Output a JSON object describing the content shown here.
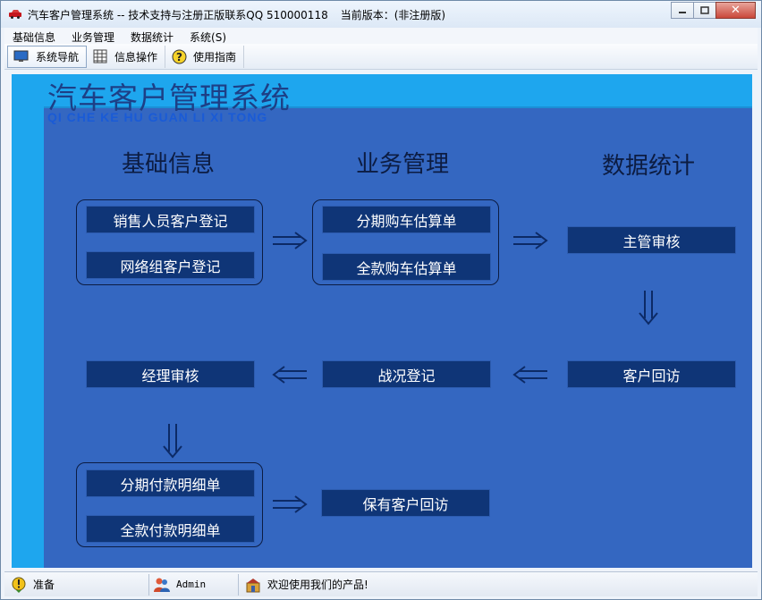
{
  "window": {
    "title": "汽车客户管理系统 -- 技术支持与注册正版联系QQ 510000118",
    "version_label": "当前版本：(非注册版)",
    "minimize": "▭",
    "maximize": "□",
    "close": "✕"
  },
  "menu": [
    {
      "label": "基础信息"
    },
    {
      "label": "业务管理"
    },
    {
      "label": "数据统计"
    },
    {
      "label": "系统(S)"
    }
  ],
  "toolbar": [
    {
      "label": "系统导航",
      "icon": "monitor-icon"
    },
    {
      "label": "信息操作",
      "icon": "grid-icon"
    },
    {
      "label": "使用指南",
      "icon": "help-icon"
    }
  ],
  "banner": {
    "title": "汽车客户管理系统",
    "subtitle": "QI CHE KE HU GUAN LI XI TONG"
  },
  "sections": {
    "basic": "基础信息",
    "business": "业务管理",
    "stats": "数据统计"
  },
  "flow": {
    "sales_register": "销售人员客户登记",
    "network_register": "网络组客户登记",
    "installment_estimate": "分期购车估算单",
    "full_estimate": "全款购车估算单",
    "manager_review": "主管审核",
    "customer_visit": "客户回访",
    "battle_register": "战况登记",
    "manager_audit": "经理审核",
    "installment_detail": "分期付款明细单",
    "full_detail": "全款付款明细单",
    "retained_visit": "保有客户回访"
  },
  "status": {
    "ready": "准备",
    "user": "Admin",
    "welcome": "欢迎使用我们的产品!"
  },
  "colors": {
    "canvas": "#3467c1",
    "strip": "#1ea6ee",
    "button": "#0f3577",
    "ink": "#0c1c42"
  }
}
